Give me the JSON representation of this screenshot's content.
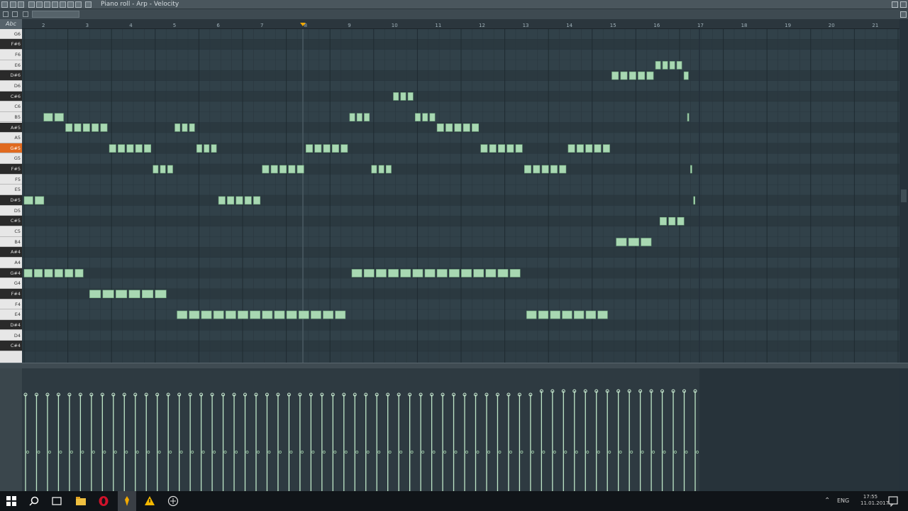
{
  "window": {
    "title": "Piano roll - Arp - Velocity"
  },
  "keyboard": {
    "corner_label": "Abc",
    "keys": [
      "G6",
      "F#6",
      "F6",
      "E6",
      "D#6",
      "D6",
      "C#6",
      "C6",
      "B5",
      "A#5",
      "A5",
      "G#5",
      "G5",
      "F#5",
      "F5",
      "E5",
      "D#5",
      "D5",
      "C#5",
      "C5",
      "B4",
      "A#4",
      "A4",
      "G#4",
      "G4",
      "F#4",
      "F4",
      "E4",
      "D#4",
      "D4",
      "C#4"
    ],
    "active_key": "G#5"
  },
  "ruler": {
    "labels": [
      "2",
      "3",
      "4",
      "5",
      "6",
      "7",
      "8",
      "9",
      "10",
      "11",
      "12",
      "13",
      "14",
      "15",
      "16",
      "17",
      "18",
      "19",
      "20",
      "21"
    ]
  },
  "notes": [
    {
      "row": "D#5",
      "start": 0,
      "len": 0.5,
      "count": 2
    },
    {
      "row": "B5",
      "start": 0.45,
      "len": 0.5,
      "count": 2
    },
    {
      "row": "A#5",
      "start": 0.95,
      "len": 1.0,
      "count": 5
    },
    {
      "row": "G#5",
      "start": 1.95,
      "len": 1.0,
      "count": 5
    },
    {
      "row": "F#5",
      "start": 2.95,
      "len": 0.5,
      "count": 3
    },
    {
      "row": "A#5",
      "start": 3.45,
      "len": 0.5,
      "count": 3
    },
    {
      "row": "G#5",
      "start": 3.95,
      "len": 0.5,
      "count": 3
    },
    {
      "row": "D#5",
      "start": 4.45,
      "len": 1.0,
      "count": 5
    },
    {
      "row": "F#5",
      "start": 5.45,
      "len": 1.0,
      "count": 5
    },
    {
      "row": "G#5",
      "start": 6.45,
      "len": 1.0,
      "count": 5
    },
    {
      "row": "B5",
      "start": 7.45,
      "len": 0.5,
      "count": 3
    },
    {
      "row": "F#5",
      "start": 7.95,
      "len": 0.5,
      "count": 3
    },
    {
      "row": "C#6",
      "start": 8.45,
      "len": 0.5,
      "count": 3
    },
    {
      "row": "B5",
      "start": 8.95,
      "len": 0.5,
      "count": 3
    },
    {
      "row": "A#5",
      "start": 9.45,
      "len": 1.0,
      "count": 5
    },
    {
      "row": "G#5",
      "start": 10.45,
      "len": 1.0,
      "count": 5
    },
    {
      "row": "F#5",
      "start": 11.45,
      "len": 1.0,
      "count": 5
    },
    {
      "row": "G#5",
      "start": 12.45,
      "len": 1.0,
      "count": 5
    },
    {
      "row": "D#6",
      "start": 13.45,
      "len": 1.0,
      "count": 5
    },
    {
      "row": "E6",
      "start": 14.45,
      "len": 0.65,
      "count": 4
    },
    {
      "row": "D#6",
      "start": 15.1,
      "len": 0.15,
      "count": 1
    },
    {
      "row": "B5",
      "start": 15.18,
      "len": 0.05,
      "count": 1
    },
    {
      "row": "F#5",
      "start": 15.25,
      "len": 0.05,
      "count": 1
    },
    {
      "row": "D#5",
      "start": 15.32,
      "len": 0.05,
      "count": 1
    },
    {
      "row": "B4",
      "start": 13.55,
      "len": 0.85,
      "count": 3
    },
    {
      "row": "C#5",
      "start": 14.55,
      "len": 0.6,
      "count": 3
    },
    {
      "row": "G#4",
      "start": 0,
      "len": 1.4,
      "count": 6
    },
    {
      "row": "F#4",
      "start": 1.5,
      "len": 1.8,
      "count": 6
    },
    {
      "row": "E4",
      "start": 3.5,
      "len": 3.9,
      "count": 14
    },
    {
      "row": "G#4",
      "start": 7.5,
      "len": 3.9,
      "count": 14
    },
    {
      "row": "E4",
      "start": 11.5,
      "len": 1.9,
      "count": 7
    }
  ],
  "velocity": {
    "bar_count": 62
  },
  "taskbar": {
    "lang": "ENG",
    "time": "17:55",
    "date": "11.01.2017"
  }
}
